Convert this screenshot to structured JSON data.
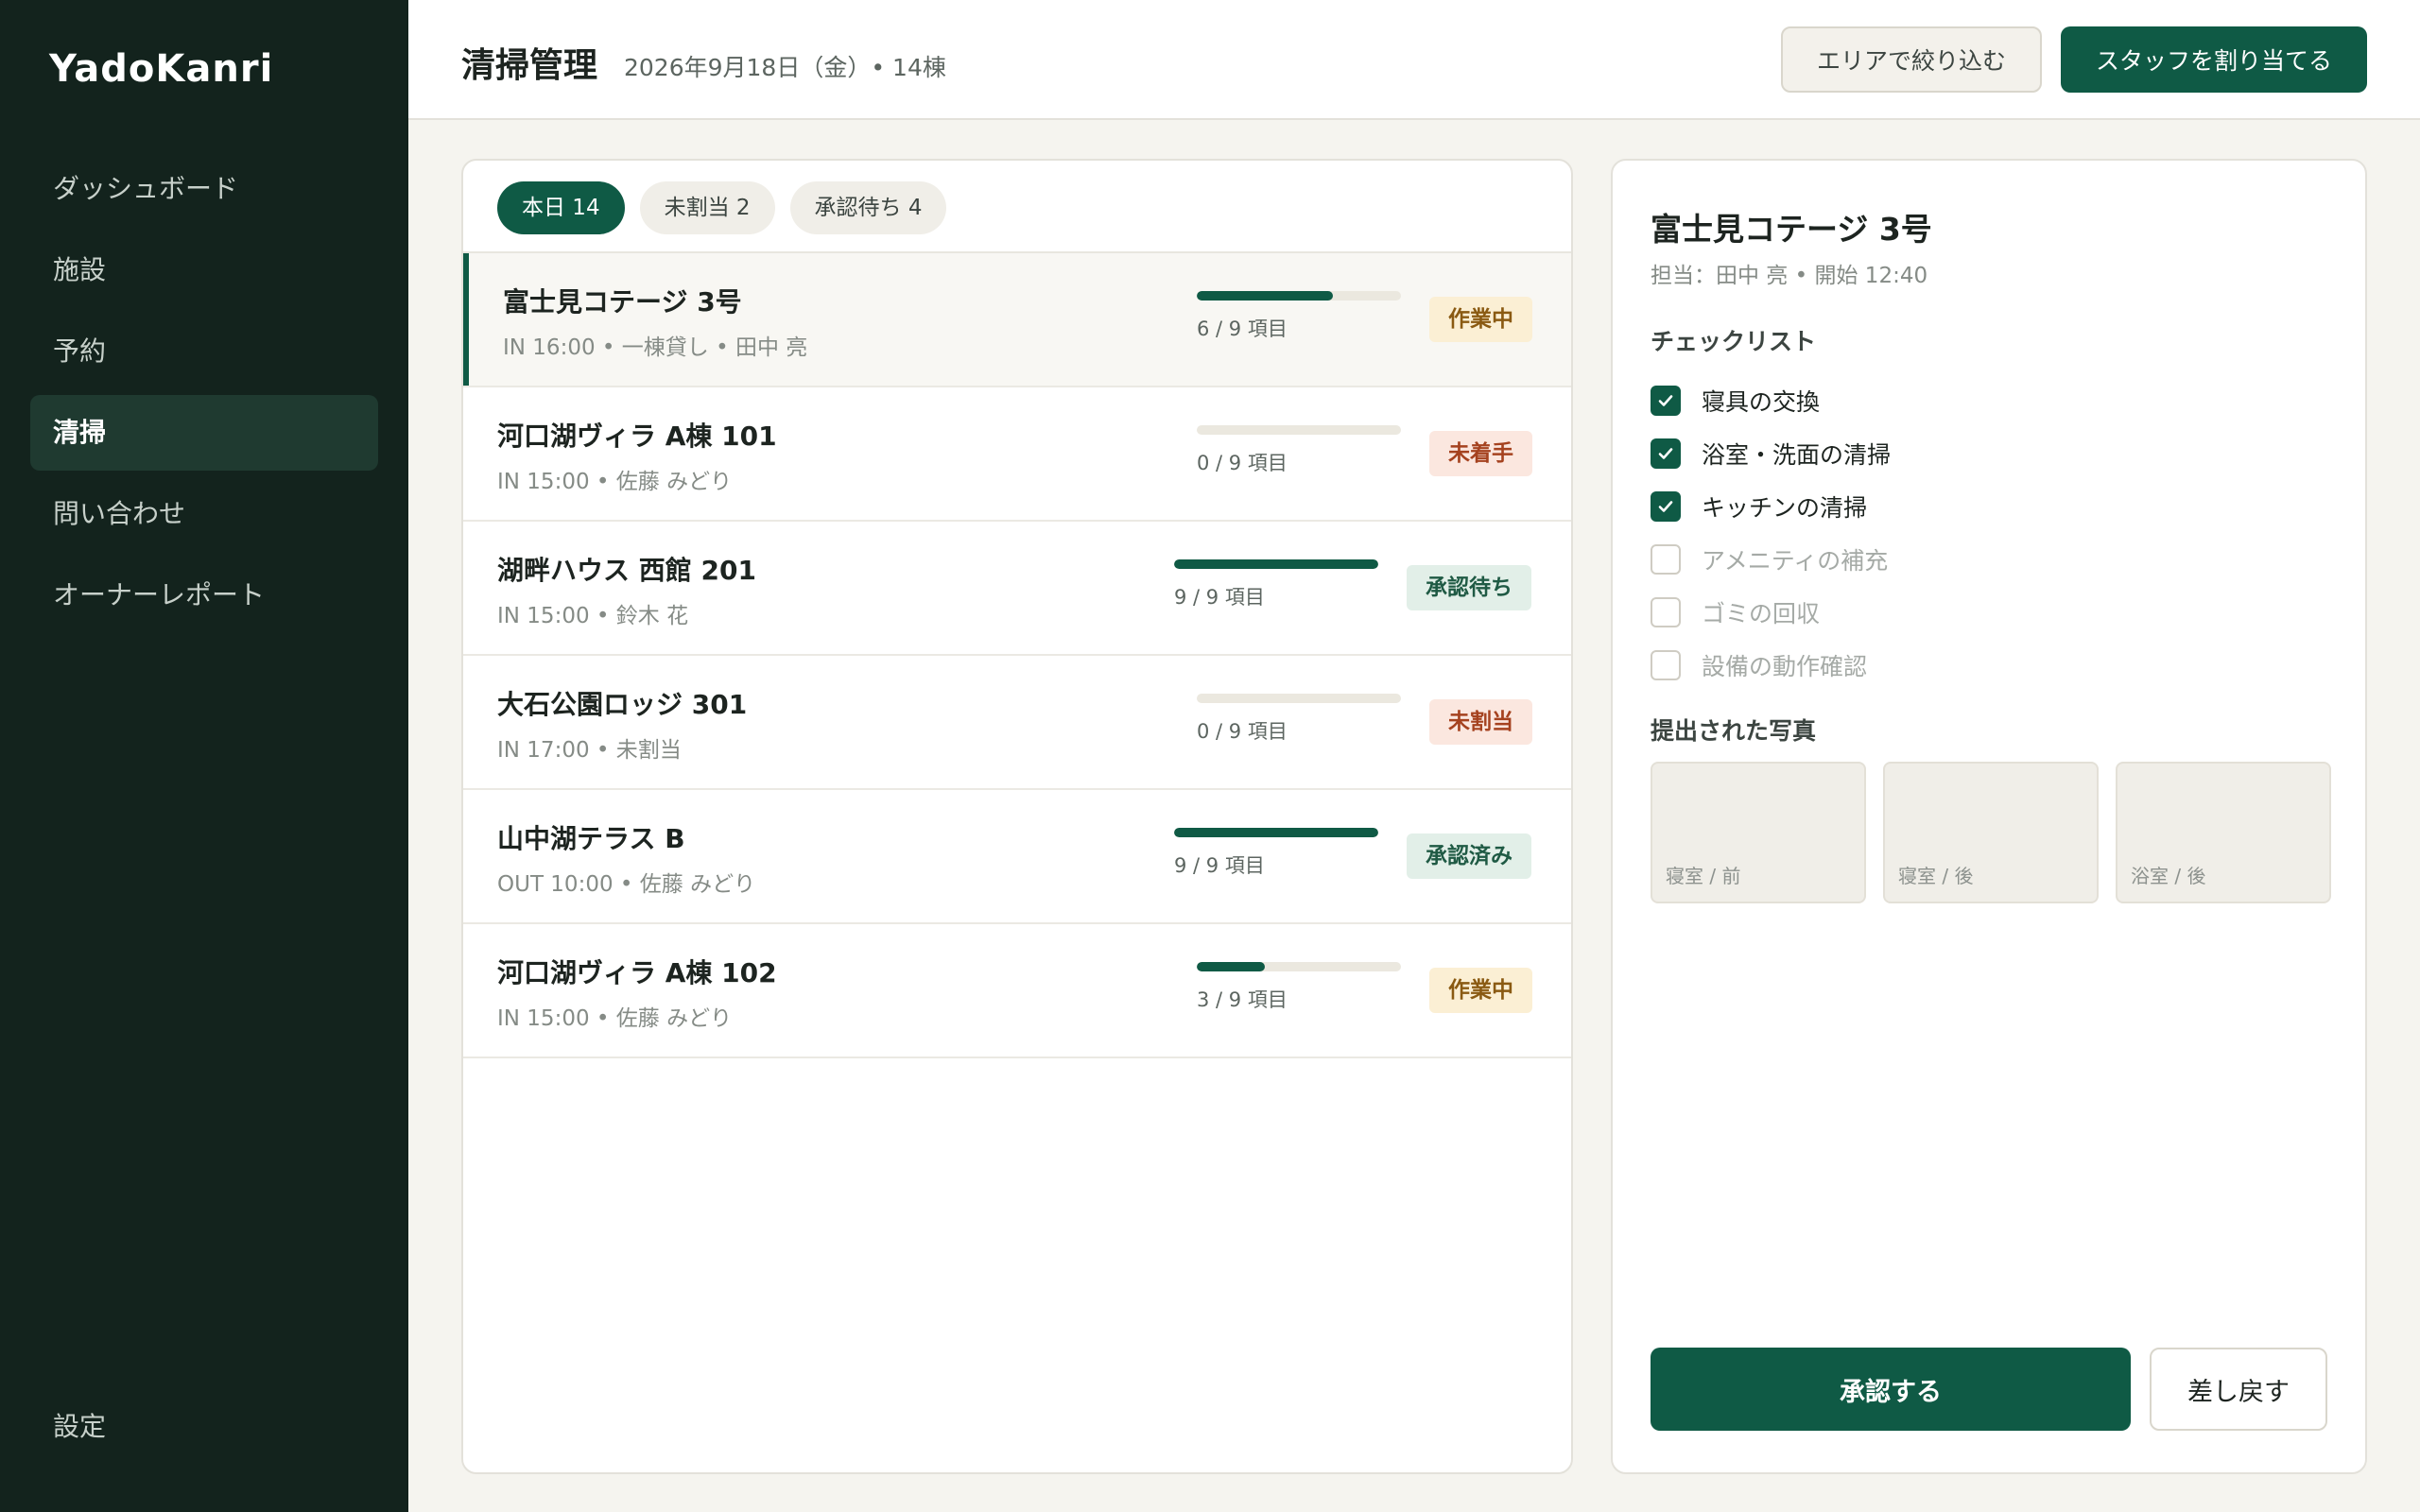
{
  "app": {
    "name": "YadoKanri"
  },
  "sidebar": {
    "items": [
      {
        "label": "ダッシュボード",
        "active": false
      },
      {
        "label": "施設",
        "active": false
      },
      {
        "label": "予約",
        "active": false
      },
      {
        "label": "清掃",
        "active": true
      },
      {
        "label": "問い合わせ",
        "active": false
      },
      {
        "label": "オーナーレポート",
        "active": false
      }
    ],
    "settings_label": "設定"
  },
  "header": {
    "title": "清掃管理",
    "subtitle": "2026年9月18日（金）• 14棟",
    "filter_label": "エリアで絞り込む",
    "assign_label": "スタッフを割り当てる"
  },
  "tabs": [
    {
      "label": "本日 14",
      "active": true
    },
    {
      "label": "未割当 2",
      "active": false
    },
    {
      "label": "承認待ち 4",
      "active": false
    }
  ],
  "rows": [
    {
      "name": "富士見コテージ 3号",
      "meta": "IN 16:00 • 一棟貸し • 田中 亮",
      "progress": 0.667,
      "progress_label": "6 / 9 項目",
      "status": "作業中",
      "status_type": "working",
      "selected": true
    },
    {
      "name": "河口湖ヴィラ A棟 101",
      "meta": "IN 15:00 • 佐藤 みどり",
      "progress": 0,
      "progress_label": "0 / 9 項目",
      "status": "未着手",
      "status_type": "not-started",
      "selected": false
    },
    {
      "name": "湖畔ハウス 西館 201",
      "meta": "IN 15:00 • 鈴木 花",
      "progress": 1,
      "progress_label": "9 / 9 項目",
      "status": "承認待ち",
      "status_type": "pending",
      "selected": false
    },
    {
      "name": "大石公園ロッジ 301",
      "meta": "IN 17:00 • 未割当",
      "progress": 0,
      "progress_label": "0 / 9 項目",
      "status": "未割当",
      "status_type": "unassigned",
      "selected": false
    },
    {
      "name": "山中湖テラス B",
      "meta": "OUT 10:00 • 佐藤 みどり",
      "progress": 1,
      "progress_label": "9 / 9 項目",
      "status": "承認済み",
      "status_type": "approved",
      "selected": false
    },
    {
      "name": "河口湖ヴィラ A棟 102",
      "meta": "IN 15:00 • 佐藤 みどり",
      "progress": 0.333,
      "progress_label": "3 / 9 項目",
      "status": "作業中",
      "status_type": "working",
      "selected": false
    }
  ],
  "detail": {
    "title": "富士見コテージ 3号",
    "subtitle": "担当：田中 亮 • 開始 12:40",
    "checklist_title": "チェックリスト",
    "checklist": [
      {
        "label": "寝具の交換",
        "checked": true
      },
      {
        "label": "浴室・洗面の清掃",
        "checked": true
      },
      {
        "label": "キッチンの清掃",
        "checked": true
      },
      {
        "label": "アメニティの補充",
        "checked": false
      },
      {
        "label": "ゴミの回収",
        "checked": false
      },
      {
        "label": "設備の動作確認",
        "checked": false
      }
    ],
    "photos_title": "提出された写真",
    "photos": [
      {
        "label": "寝室 / 前"
      },
      {
        "label": "寝室 / 後"
      },
      {
        "label": "浴室 / 後"
      }
    ],
    "approve_label": "承認する",
    "return_label": "差し戻す"
  },
  "colors": {
    "accent": "#0f5a45",
    "sidebar_bg": "#13231d",
    "page_bg": "#f5f4ef"
  }
}
